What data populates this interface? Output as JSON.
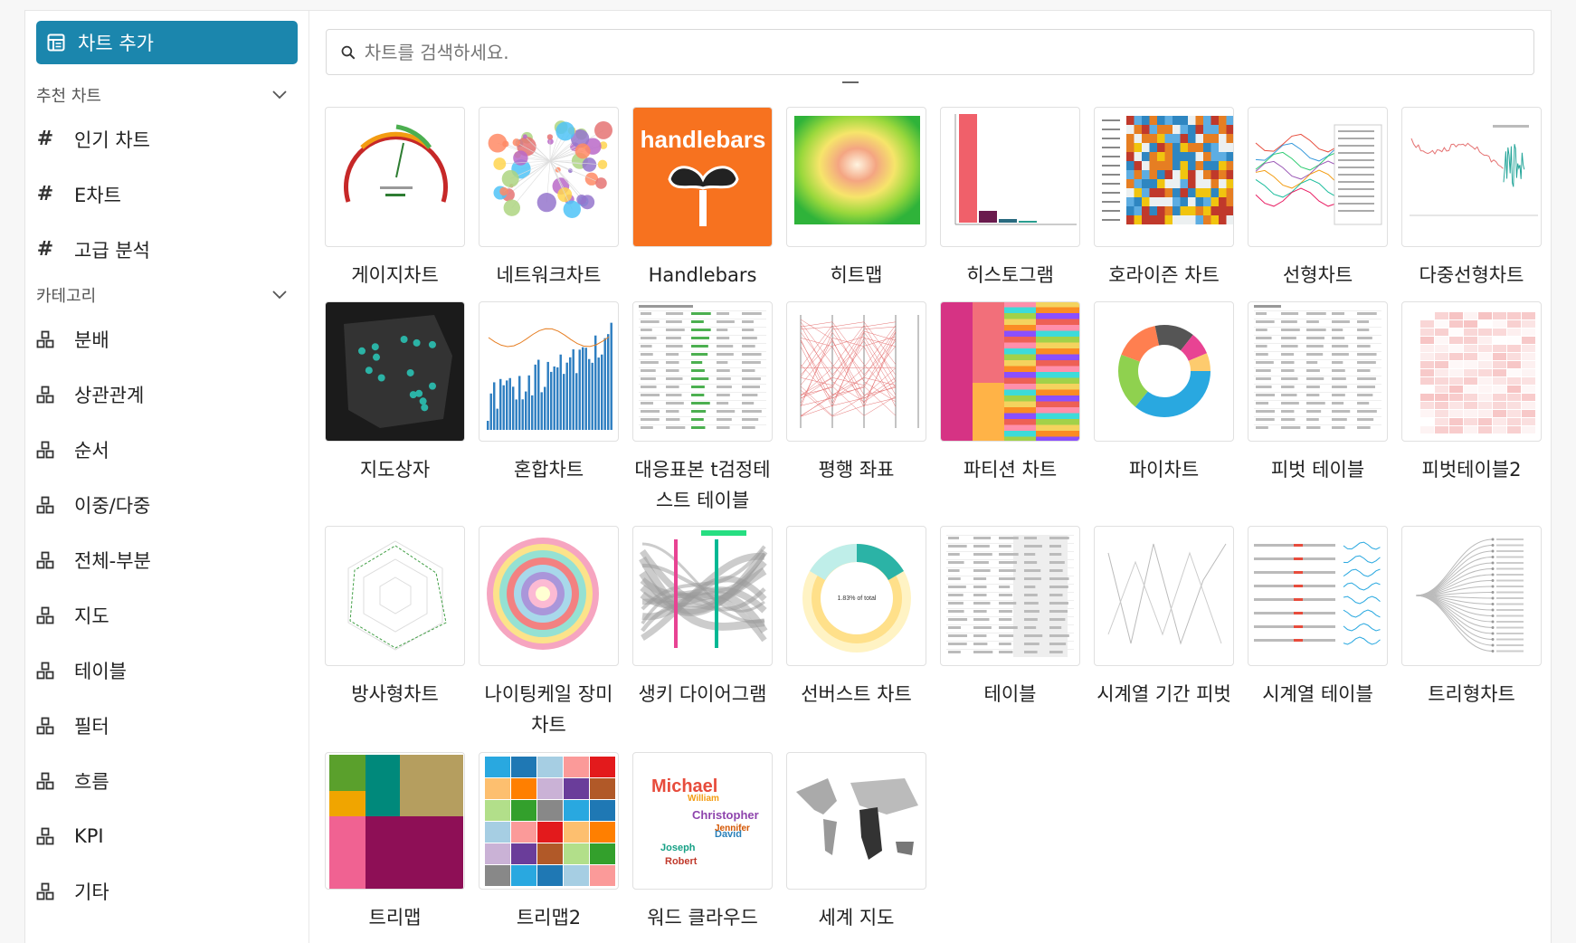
{
  "sidebar": {
    "add_chart_label": "차트 추가",
    "recommended_header": "추천 차트",
    "recommended": [
      {
        "label": "인기 차트"
      },
      {
        "label": "E차트"
      },
      {
        "label": "고급 분석"
      }
    ],
    "category_header": "카테고리",
    "categories": [
      {
        "label": "분배"
      },
      {
        "label": "상관관계"
      },
      {
        "label": "순서"
      },
      {
        "label": "이중/다중"
      },
      {
        "label": "전체-부분"
      },
      {
        "label": "지도"
      },
      {
        "label": "테이블"
      },
      {
        "label": "필터"
      },
      {
        "label": "흐름"
      },
      {
        "label": "KPI"
      },
      {
        "label": "기타"
      }
    ]
  },
  "search": {
    "placeholder": "차트를 검색하세요."
  },
  "charts": [
    {
      "label": "게이지차트",
      "icon": "gauge-thumbnail"
    },
    {
      "label": "네트워크차트",
      "icon": "network-thumbnail"
    },
    {
      "label": "Handlebars",
      "icon": "handlebars-thumbnail",
      "logo_text": "handlebars"
    },
    {
      "label": "히트맵",
      "icon": "heatmap-thumbnail"
    },
    {
      "label": "히스토그램",
      "icon": "histogram-thumbnail"
    },
    {
      "label": "호라이즌 차트",
      "icon": "horizon-thumbnail"
    },
    {
      "label": "선형차트",
      "icon": "line-thumbnail"
    },
    {
      "label": "다중선형차트",
      "icon": "multiline-thumbnail"
    },
    {
      "label": "지도상자",
      "icon": "mapbox-thumbnail"
    },
    {
      "label": "혼합차트",
      "icon": "mixed-thumbnail"
    },
    {
      "label": "대응표본 t검정테스트 테이블",
      "icon": "ttest-thumbnail"
    },
    {
      "label": "평행 좌표",
      "icon": "parallel-thumbnail"
    },
    {
      "label": "파티션 차트",
      "icon": "partition-thumbnail"
    },
    {
      "label": "파이차트",
      "icon": "pie-thumbnail"
    },
    {
      "label": "피벗 테이블",
      "icon": "pivot-thumbnail"
    },
    {
      "label": "피벗테이블2",
      "icon": "pivot2-thumbnail"
    },
    {
      "label": "방사형차트",
      "icon": "radar-thumbnail"
    },
    {
      "label": "나이팅케일 장미 차트",
      "icon": "rose-thumbnail"
    },
    {
      "label": "생키 다이어그램",
      "icon": "sankey-thumbnail"
    },
    {
      "label": "선버스트 차트",
      "icon": "sunburst-thumbnail",
      "center_text": "1.83% of total"
    },
    {
      "label": "테이블",
      "icon": "table-thumbnail"
    },
    {
      "label": "시계열 기간 피벗",
      "icon": "ts-pivot-thumbnail"
    },
    {
      "label": "시계열 테이블",
      "icon": "ts-table-thumbnail"
    },
    {
      "label": "트리형차트",
      "icon": "tree-thumbnail"
    },
    {
      "label": "트리맵",
      "icon": "treemap-thumbnail"
    },
    {
      "label": "트리맵2",
      "icon": "treemap2-thumbnail"
    },
    {
      "label": "워드 클라우드",
      "icon": "wordcloud-thumbnail",
      "words": [
        "Michael",
        "Christopher",
        "David",
        "William",
        "Jennifer",
        "Joseph",
        "Robert"
      ]
    },
    {
      "label": "세계 지도",
      "icon": "worldmap-thumbnail"
    }
  ]
}
